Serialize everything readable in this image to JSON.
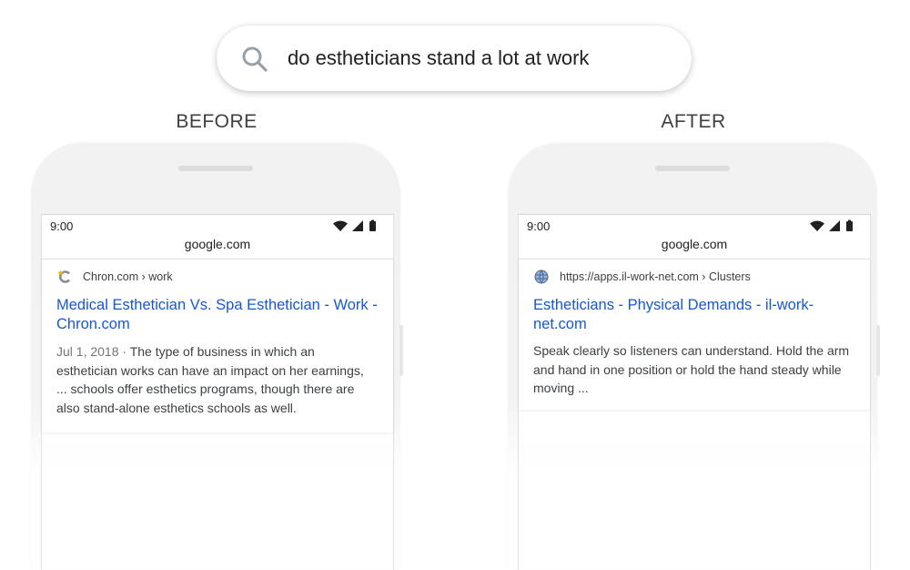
{
  "search": {
    "query": "do estheticians stand a lot at work",
    "icon": "search-icon"
  },
  "panels": [
    {
      "label": "BEFORE",
      "status_time": "9:00",
      "url": "google.com",
      "source": "Chron.com › work",
      "title_line1": "Medical Esthetician Vs. Spa Esthetician - Work -",
      "title_line2": "Chron.com",
      "date": "Jul 1, 2018 · ",
      "snippet_line1_rest": "The type of business in which an",
      "snippet_line2": "esthetician works can have an impact on her earnings,",
      "snippet_line3": "... schools offer esthetics programs, though there are",
      "snippet_line4": "also stand-alone esthetics schools as well."
    },
    {
      "label": "AFTER",
      "status_time": "9:00",
      "url": "google.com",
      "source": "https://apps.il-work-net.com › Clusters",
      "title_line1": "Estheticians - Physical Demands - il-work-",
      "title_line2": "net.com",
      "snippet_line1": "Speak clearly so listeners can understand. Hold the arm",
      "snippet_line2": "and hand in one position or hold the hand steady while",
      "snippet_line3": "moving ..."
    }
  ],
  "colors": {
    "link": "#1558d6",
    "text": "#3c4043",
    "muted": "#70757a"
  }
}
